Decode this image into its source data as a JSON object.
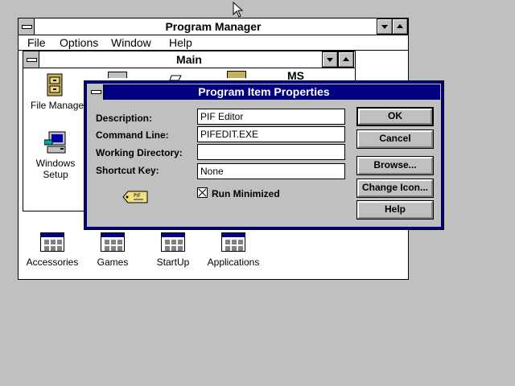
{
  "program_manager": {
    "title": "Program Manager",
    "menu": [
      {
        "label": "File",
        "u": "F"
      },
      {
        "label": "Options",
        "u": "O"
      },
      {
        "label": "Window",
        "u": "W"
      },
      {
        "label": "Help",
        "u": "H"
      }
    ],
    "main_group": {
      "title": "Main",
      "icons": [
        {
          "label": "File Manager",
          "icon": "file-manager-icon"
        },
        {
          "label": "Windows",
          "label2": "Setup",
          "icon": "windows-setup-icon"
        },
        {
          "label": "",
          "icon": "pif-editor-icon"
        }
      ],
      "partial_top_text": "MS"
    },
    "group_icons": [
      {
        "label": "Accessories"
      },
      {
        "label": "Games"
      },
      {
        "label": "StartUp"
      },
      {
        "label": "Applications"
      }
    ]
  },
  "dialog": {
    "title": "Program Item Properties",
    "fields": {
      "description": {
        "label": "Description:",
        "value": "PIF Editor"
      },
      "command_line": {
        "label": "Command Line:",
        "value": "PIFEDIT.EXE"
      },
      "working_directory": {
        "label": "Working Directory:",
        "value": ""
      },
      "shortcut_key": {
        "label": "Shortcut Key:",
        "value": "None"
      }
    },
    "run_minimized": {
      "label": "Run Minimized",
      "checked": true
    },
    "buttons": {
      "ok": "OK",
      "cancel": "Cancel",
      "browse": "Browse...",
      "change_icon": "Change Icon...",
      "help": "Help"
    },
    "pif_icon_text": "PIF"
  },
  "colors": {
    "desktop": "#c0c0c0",
    "title_active": "#000080",
    "face": "#c0c0c0"
  }
}
